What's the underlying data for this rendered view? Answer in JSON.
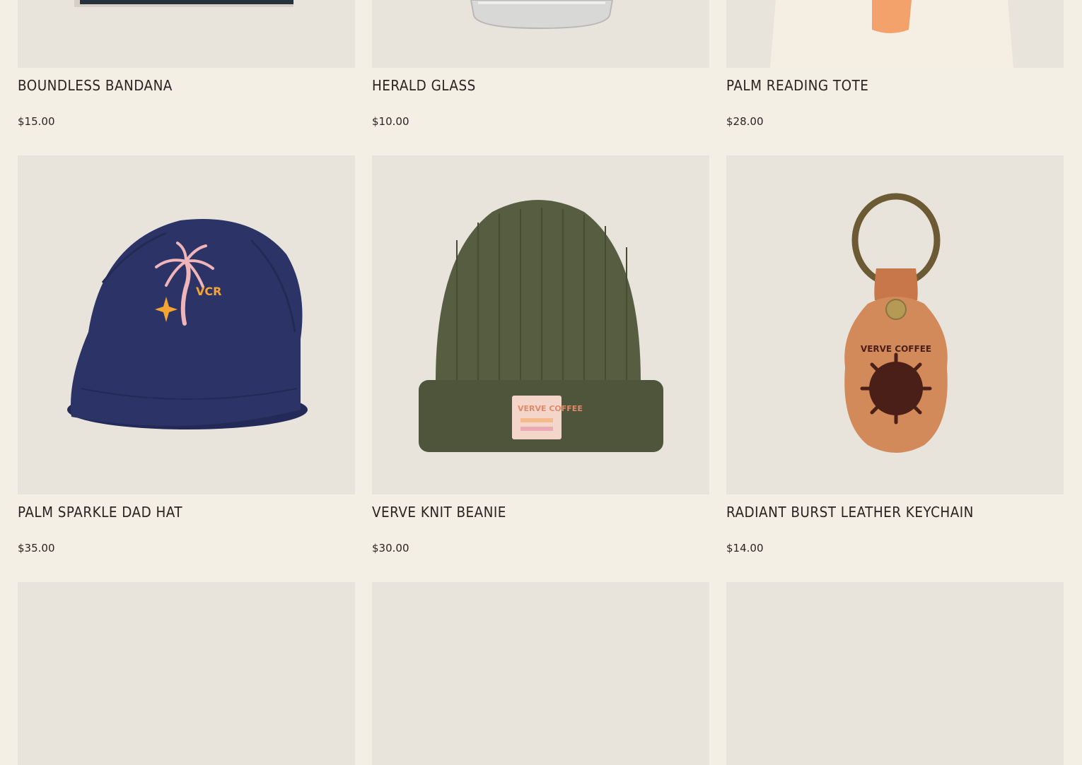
{
  "products": [
    {
      "title": "Boundless Bandana",
      "price": "$15.00",
      "image_icon": "bandana-image"
    },
    {
      "title": "Herald Glass",
      "price": "$10.00",
      "image_icon": "glass-image"
    },
    {
      "title": "Palm Reading Tote",
      "price": "$28.00",
      "image_icon": "tote-image"
    },
    {
      "title": "Palm Sparkle Dad Hat",
      "price": "$35.00",
      "image_icon": "cap-image",
      "embroidery": "VCR"
    },
    {
      "title": "Verve Knit Beanie",
      "price": "$30.00",
      "image_icon": "beanie-image",
      "label_text": "VERVE COFFEE"
    },
    {
      "title": "Radiant Burst Leather Keychain",
      "price": "$14.00",
      "image_icon": "keychain-image",
      "stamp_text": "VERVE COFFEE"
    }
  ],
  "colors": {
    "page_bg": "#f4efe5",
    "image_bg": "#e8e4dc",
    "text": "#2b2320",
    "cap_navy": "#2c3467",
    "beanie_olive": "#545a3f",
    "leather_tan": "#d38a5b"
  }
}
